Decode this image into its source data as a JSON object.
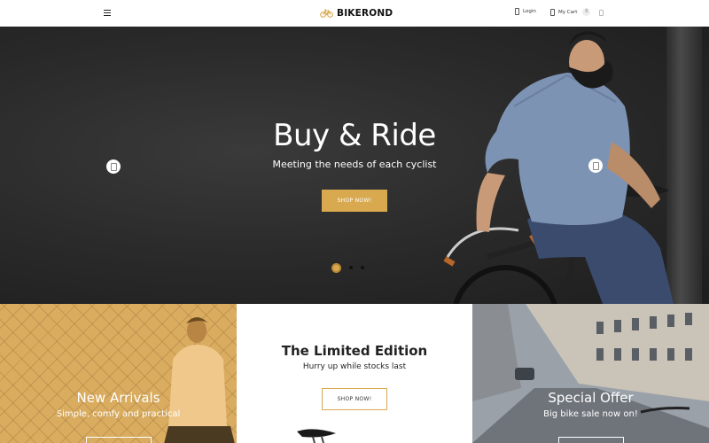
{
  "header": {
    "brand": "BIKEROND",
    "login_label": "Login",
    "cart_label": "My Cart",
    "cart_count": "0"
  },
  "hero": {
    "title": "Buy & Ride",
    "subtitle": "Meeting the needs of each cyclist",
    "button_label": "SHOP NOW!",
    "active_slide": 1,
    "slide_count": 3
  },
  "banners": [
    {
      "title": "New Arrivals",
      "subtitle": "Simple, comfy and practical"
    },
    {
      "title": "The Limited Edition",
      "subtitle": "Hurry up while stocks last",
      "button_label": "SHOP NOW!"
    },
    {
      "title": "Special Offer",
      "subtitle": "Big bike sale now on!"
    }
  ],
  "colors": {
    "accent": "#d9a94f",
    "hero_bg": "#2a2a2a"
  },
  "icons": {
    "menu": "hamburger-icon",
    "brand": "bicycle-icon",
    "login": "phone-icon",
    "cart": "phone-icon",
    "settings": "phone-icon",
    "slider_prev": "arrow-left-icon",
    "slider_next": "arrow-right-icon"
  }
}
